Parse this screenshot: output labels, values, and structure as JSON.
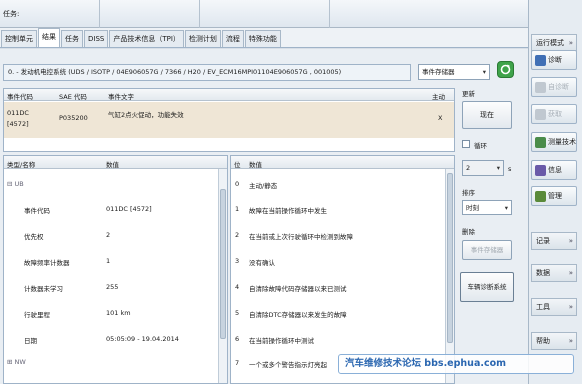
{
  "topbar": {
    "task_label": "任务:"
  },
  "tabs": [
    "控制单元",
    "结果",
    "任务",
    "DISS",
    "产品技术信息（TPI）",
    "检测计划",
    "流程",
    "特殊功能"
  ],
  "path_text": "0. - 发动机电控系统  (UDS / ISOTP / 04E906057G / 7366 / H20 / EV_ECM16MPI01104E906057G , 001005)",
  "memory_select": "事件存储器",
  "event_table": {
    "headers": [
      "事件代码",
      "SAE 代码",
      "事件文字",
      "主动"
    ],
    "row": {
      "code_line1": "011DC",
      "code_line2": "[4572]",
      "sae": "P035200",
      "text": "气缸2点火促动，功能失效",
      "active": "X"
    }
  },
  "right_panel": {
    "update_label": "更新",
    "now_button": "现在",
    "loop_label": "循环",
    "interval_value": "2",
    "interval_unit": "s",
    "sort_label": "排序",
    "sort_value": "时刻",
    "delete_label": "删除",
    "delete_button": "事件存储器",
    "diag_button": "车辆诊断系统"
  },
  "detail_left": {
    "headers": [
      "类型/名称",
      "数值"
    ],
    "group1": "UB",
    "rows": [
      {
        "name": "事件代码",
        "value": "011DC [4572]"
      },
      {
        "name": "优先权",
        "value": "2"
      },
      {
        "name": "故障频率计数器",
        "value": "1"
      },
      {
        "name": "计数器未学习",
        "value": "255"
      },
      {
        "name": "行驶里程",
        "value": "101 km"
      },
      {
        "name": "日期",
        "value": "05:05:09 - 19.04.2014"
      }
    ],
    "group2": "NW"
  },
  "detail_right": {
    "headers": [
      "位",
      "数值"
    ],
    "rows": [
      {
        "bit": "0",
        "value": "主动/静态"
      },
      {
        "bit": "1",
        "value": "故障在当前操作循环中发生"
      },
      {
        "bit": "2",
        "value": "在当前或上次行驶循环中检测到故障"
      },
      {
        "bit": "3",
        "value": "没有确认"
      },
      {
        "bit": "4",
        "value": "自清除故障代码存储器以来已测试"
      },
      {
        "bit": "5",
        "value": "自清除DTC存储器以来发生的故障"
      },
      {
        "bit": "6",
        "value": "在当前操作循环中测试"
      },
      {
        "bit": "7",
        "value": "一个或多个警告指示灯亮起"
      }
    ]
  },
  "sidebar": {
    "mode_label": "运行模式",
    "buttons": [
      {
        "label": "诊断",
        "color": "#3f6fb5",
        "enabled": true
      },
      {
        "label": "自诊断",
        "color": "#c0c8d0",
        "enabled": false
      },
      {
        "label": "获取",
        "color": "#c0c8d0",
        "enabled": false
      },
      {
        "label": "测量技术",
        "color": "#4a8c4a",
        "enabled": true
      },
      {
        "label": "信息",
        "color": "#6a5aa8",
        "enabled": true
      },
      {
        "label": "管理",
        "color": "#5a8a3a",
        "enabled": true
      }
    ],
    "sections": [
      "记录",
      "数据",
      "工具",
      "帮助"
    ]
  },
  "watermark": "汽车维修技术论坛 bbs.ephua.com"
}
